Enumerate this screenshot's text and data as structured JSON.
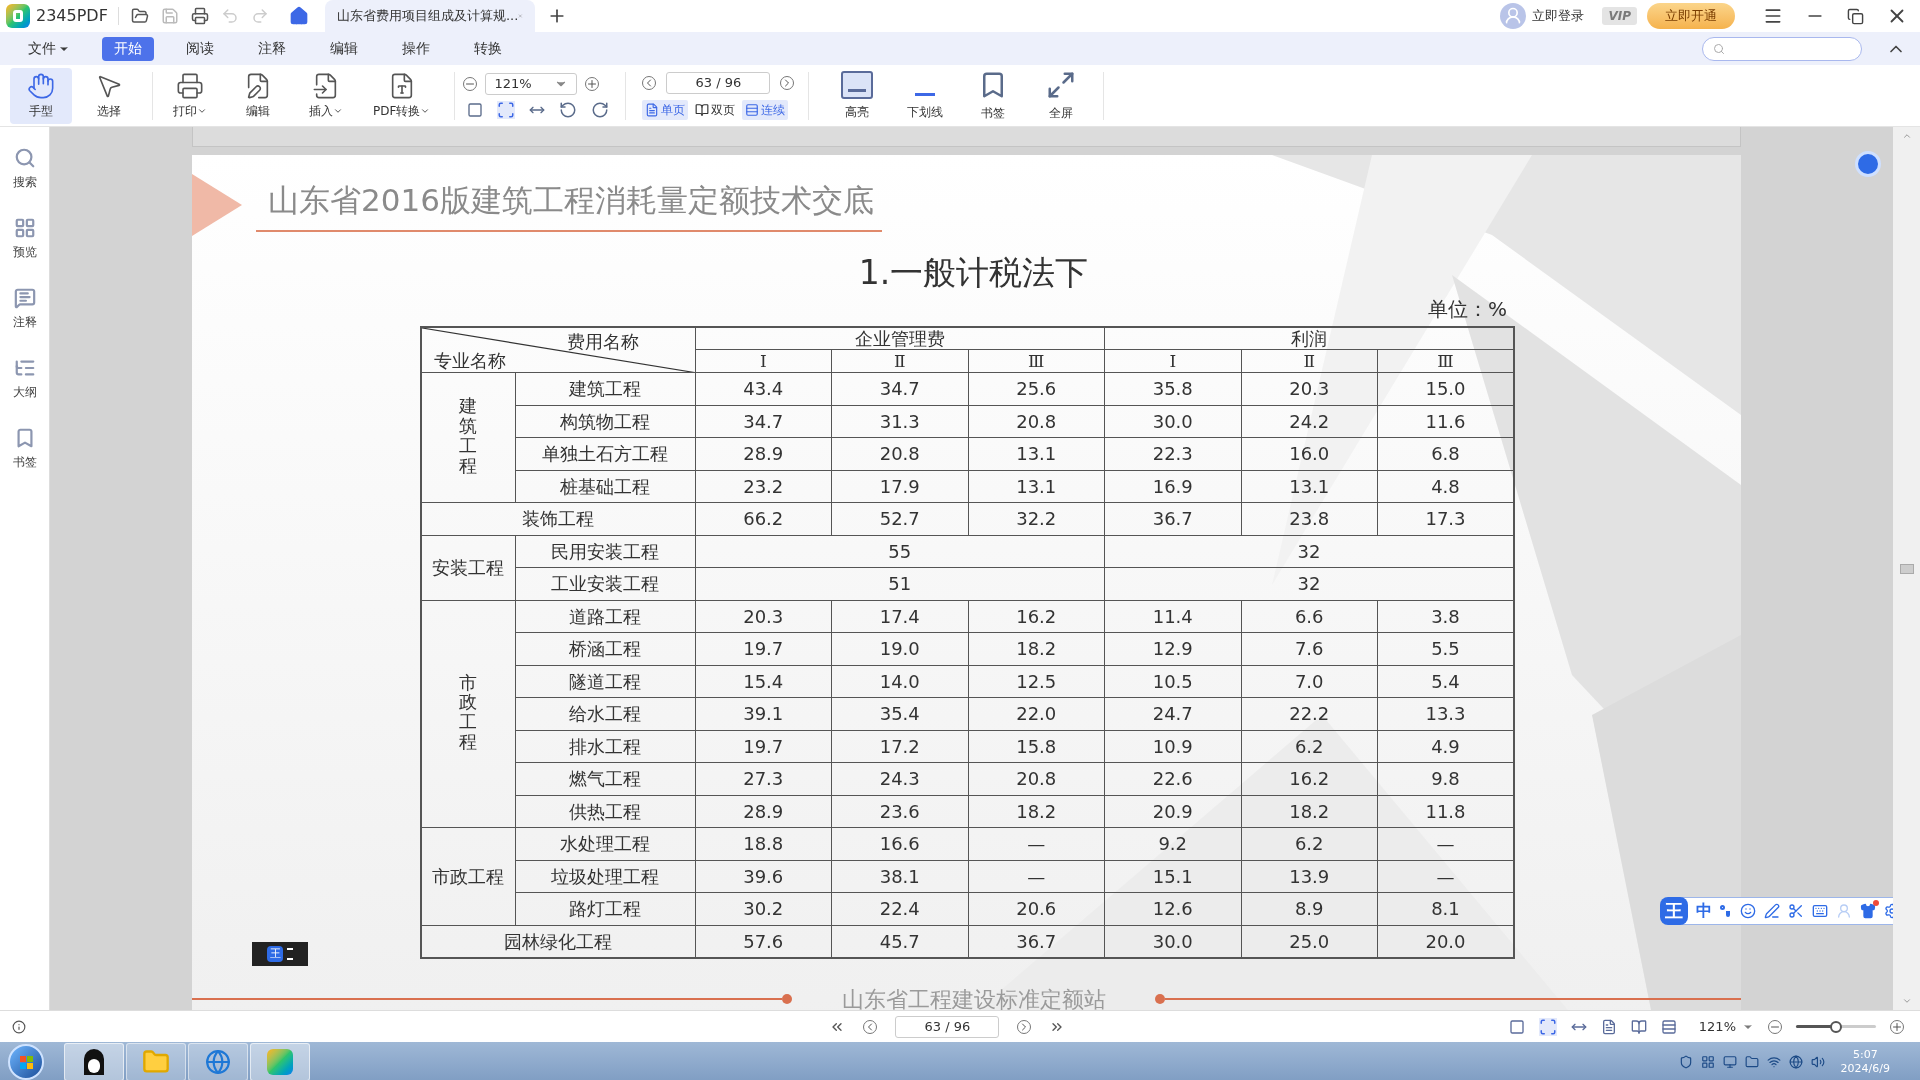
{
  "app": {
    "name": "2345PDF"
  },
  "document_tab": {
    "title": "山东省费用项目组成及计算规...",
    "selected": true
  },
  "account": {
    "login": "立即登录",
    "vip": "VIP",
    "activate": "立即开通"
  },
  "menu": [
    {
      "label": "文件",
      "dropdown": true,
      "selected": false
    },
    {
      "label": "开始",
      "dropdown": false,
      "selected": true
    },
    {
      "label": "阅读",
      "dropdown": false,
      "selected": false
    },
    {
      "label": "注释",
      "dropdown": false,
      "selected": false
    },
    {
      "label": "编辑",
      "dropdown": false,
      "selected": false
    },
    {
      "label": "操作",
      "dropdown": false,
      "selected": false
    },
    {
      "label": "转换",
      "dropdown": false,
      "selected": false
    }
  ],
  "tools": [
    {
      "label": "手型",
      "kind": "hand",
      "dropdown": false,
      "selected": true
    },
    {
      "label": "选择",
      "kind": "select",
      "dropdown": false,
      "selected": false
    },
    {
      "label": "打印",
      "kind": "print",
      "dropdown": true,
      "selected": false
    },
    {
      "label": "编辑",
      "kind": "edit",
      "dropdown": false,
      "selected": false
    },
    {
      "label": "插入",
      "kind": "insert",
      "dropdown": true,
      "selected": false
    },
    {
      "label": "PDF转换",
      "kind": "convert",
      "dropdown": true,
      "selected": false
    }
  ],
  "zoom": {
    "value": "121%"
  },
  "page_nav": {
    "value": "63 / 96"
  },
  "view_modes": [
    {
      "label": "单页",
      "kind": "single",
      "selected": true
    },
    {
      "label": "双页",
      "kind": "double",
      "selected": false
    },
    {
      "label": "连续",
      "kind": "continuous",
      "selected": true
    }
  ],
  "markup_tools": [
    {
      "label": "高亮",
      "kind": "highlight"
    },
    {
      "label": "下划线",
      "kind": "underline"
    },
    {
      "label": "书签",
      "kind": "bookmark"
    },
    {
      "label": "全屏",
      "kind": "fullscreen"
    }
  ],
  "sidebar": [
    {
      "label": "搜索",
      "kind": "search"
    },
    {
      "label": "预览",
      "kind": "preview"
    },
    {
      "label": "注释",
      "kind": "comment"
    },
    {
      "label": "大纲",
      "kind": "outline"
    },
    {
      "label": "书签",
      "kind": "bookmark"
    }
  ],
  "page": {
    "title": "山东省2016版建筑工程消耗量定额技术交底",
    "subtitle": "1.一般计税法下",
    "unit": "单位：%",
    "footer": "山东省工程建设标准定额站",
    "table": {
      "corner_top": "费用名称",
      "corner_bottom": "专业名称",
      "groups": [
        {
          "label": "企业管理费",
          "sub": [
            "Ⅰ",
            "Ⅱ",
            "Ⅲ"
          ]
        },
        {
          "label": "利润",
          "sub": [
            "Ⅰ",
            "Ⅱ",
            "Ⅲ"
          ]
        }
      ],
      "sections": [
        {
          "kind": "vertical_group",
          "label": "建筑工程",
          "rows": [
            {
              "name": "建筑工程",
              "values": [
                "43.4",
                "34.7",
                "25.6",
                "35.8",
                "20.3",
                "15.0"
              ]
            },
            {
              "name": "构筑物工程",
              "values": [
                "34.7",
                "31.3",
                "20.8",
                "30.0",
                "24.2",
                "11.6"
              ]
            },
            {
              "name": "单独土石方工程",
              "values": [
                "28.9",
                "20.8",
                "13.1",
                "22.3",
                "16.0",
                "6.8"
              ]
            },
            {
              "name": "桩基础工程",
              "values": [
                "23.2",
                "17.9",
                "13.1",
                "16.9",
                "13.1",
                "4.8"
              ]
            }
          ]
        },
        {
          "kind": "single",
          "label": "装饰工程",
          "values": [
            "66.2",
            "52.7",
            "32.2",
            "36.7",
            "23.8",
            "17.3"
          ]
        },
        {
          "kind": "group",
          "label": "安装工程",
          "rows": [
            {
              "name": "民用安装工程",
              "values": [
                "55",
                "32"
              ]
            },
            {
              "name": "工业安装工程",
              "values": [
                "51",
                "32"
              ]
            }
          ]
        },
        {
          "kind": "vertical_group",
          "label": "市政工程",
          "rows": [
            {
              "name": "道路工程",
              "values": [
                "20.3",
                "17.4",
                "16.2",
                "11.4",
                "6.6",
                "3.8"
              ]
            },
            {
              "name": "桥涵工程",
              "values": [
                "19.7",
                "19.0",
                "18.2",
                "12.9",
                "7.6",
                "5.5"
              ]
            },
            {
              "name": "隧道工程",
              "values": [
                "15.4",
                "14.0",
                "12.5",
                "10.5",
                "7.0",
                "5.4"
              ]
            },
            {
              "name": "给水工程",
              "values": [
                "39.1",
                "35.4",
                "22.0",
                "24.7",
                "22.2",
                "13.3"
              ]
            },
            {
              "name": "排水工程",
              "values": [
                "19.7",
                "17.2",
                "15.8",
                "10.9",
                "6.2",
                "4.9"
              ]
            },
            {
              "name": "燃气工程",
              "values": [
                "27.3",
                "24.3",
                "20.8",
                "22.6",
                "16.2",
                "9.8"
              ]
            },
            {
              "name": "供热工程",
              "values": [
                "28.9",
                "23.6",
                "18.2",
                "20.9",
                "18.2",
                "11.8"
              ]
            }
          ]
        },
        {
          "kind": "group",
          "label": "市政工程",
          "rows": [
            {
              "name": "水处理工程",
              "values": [
                "18.8",
                "16.6",
                "—",
                "9.2",
                "6.2",
                "—"
              ]
            },
            {
              "name": "垃圾处理工程",
              "values": [
                "39.6",
                "38.1",
                "—",
                "15.1",
                "13.9",
                "—"
              ]
            },
            {
              "name": "路灯工程",
              "values": [
                "30.2",
                "22.4",
                "20.6",
                "12.6",
                "8.9",
                "8.1"
              ]
            }
          ]
        },
        {
          "kind": "single",
          "label": "园林绿化工程",
          "values": [
            "57.6",
            "45.7",
            "36.7",
            "30.0",
            "25.0",
            "20.0"
          ]
        }
      ]
    }
  },
  "ime_mini": {
    "logo": "王"
  },
  "ime_toolbar": {
    "logo": "王",
    "mode": "中"
  },
  "status_bar": {
    "page": "63 / 96",
    "zoom": "121%",
    "zoom_slider": {
      "level": 0.5
    }
  },
  "taskbar": {
    "time": "5:07",
    "date": "2024/6/9"
  }
}
